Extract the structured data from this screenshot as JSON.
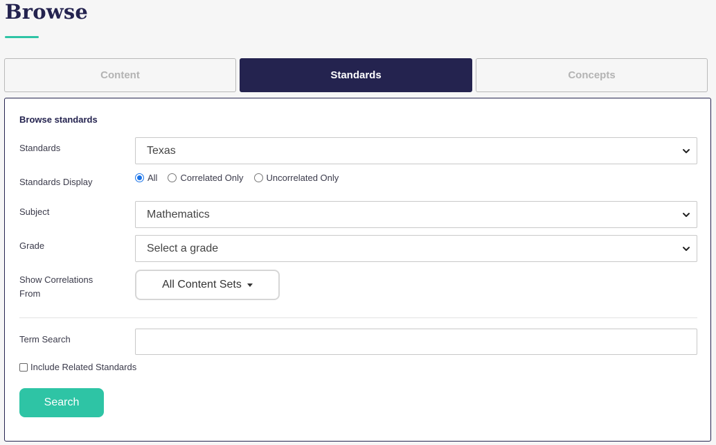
{
  "page": {
    "title": "Browse"
  },
  "tabs": [
    {
      "label": "Content",
      "active": false
    },
    {
      "label": "Standards",
      "active": true
    },
    {
      "label": "Concepts",
      "active": false
    }
  ],
  "form": {
    "heading": "Browse standards",
    "standards": {
      "label": "Standards",
      "value": "Texas"
    },
    "standards_display": {
      "label": "Standards Display",
      "options": [
        "All",
        "Correlated Only",
        "Uncorrelated Only"
      ],
      "selected": "All"
    },
    "subject": {
      "label": "Subject",
      "value": "Mathematics"
    },
    "grade": {
      "label": "Grade",
      "value": "Select a grade"
    },
    "correlations": {
      "label_line1": "Show Correlations",
      "label_line2": "From",
      "value": "All Content Sets"
    },
    "term_search": {
      "label": "Term Search",
      "value": "",
      "placeholder": ""
    },
    "include_related": {
      "label": "Include Related Standards",
      "checked": false
    },
    "search_button": "Search"
  },
  "colors": {
    "brand_navy": "#24234f",
    "accent_teal": "#2ec4a5",
    "radio_blue": "#1a73e8"
  },
  "icons": [
    "chevron-down-icon",
    "caret-down-icon",
    "radio-checked-icon",
    "checkbox-icon"
  ]
}
